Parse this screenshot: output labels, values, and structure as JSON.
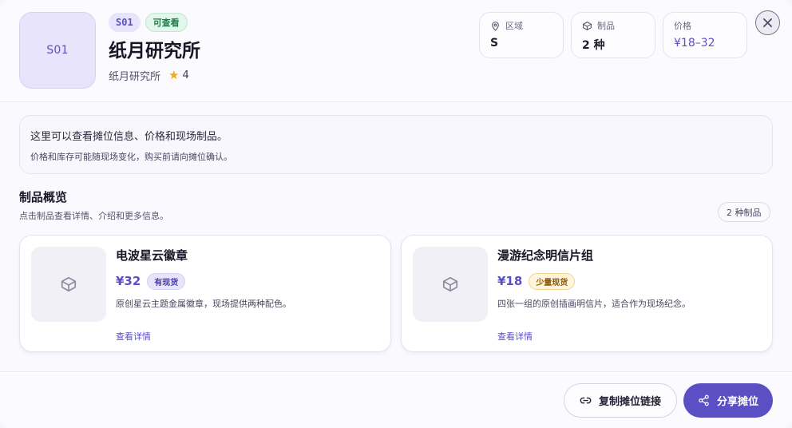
{
  "booth": {
    "logo_text": "S01",
    "code": "S01",
    "status": "可查看",
    "title": "纸月研究所",
    "circle_name": "纸月研究所",
    "rating": "4"
  },
  "stats": [
    {
      "icon": "map-pin-icon",
      "label": "区域",
      "value": "S"
    },
    {
      "icon": "package-icon",
      "label": "制品",
      "value": "2 种"
    },
    {
      "icon": "tag-icon",
      "label": "价格",
      "value": "¥18–32"
    }
  ],
  "notice": {
    "main": "这里可以查看摊位信息、价格和现场制品。",
    "sub": "价格和库存可能随现场变化，购买前请向摊位确认。"
  },
  "section": {
    "title": "制品概览",
    "subtitle": "点击制品查看详情、介绍和更多信息。",
    "count": "2 种制品"
  },
  "products": [
    {
      "name": "电波星云徽章",
      "price": "¥32",
      "stock": "有现货",
      "stock_level": "ok",
      "description": "原创星云主题金属徽章，现场提供两种配色。",
      "link": "查看详情"
    },
    {
      "name": "漫游纪念明信片组",
      "price": "¥18",
      "stock": "少量现货",
      "stock_level": "low",
      "description": "四张一组的原创插画明信片，适合作为现场纪念。",
      "link": "查看详情"
    }
  ],
  "footer": {
    "copy_label": "复制摊位链接",
    "share_label": "分享摊位"
  },
  "colors": {
    "accent": "#5b4fc4",
    "status_green": "#237a4a",
    "stock_low": "#8a5a08",
    "star": "#f2a619"
  }
}
